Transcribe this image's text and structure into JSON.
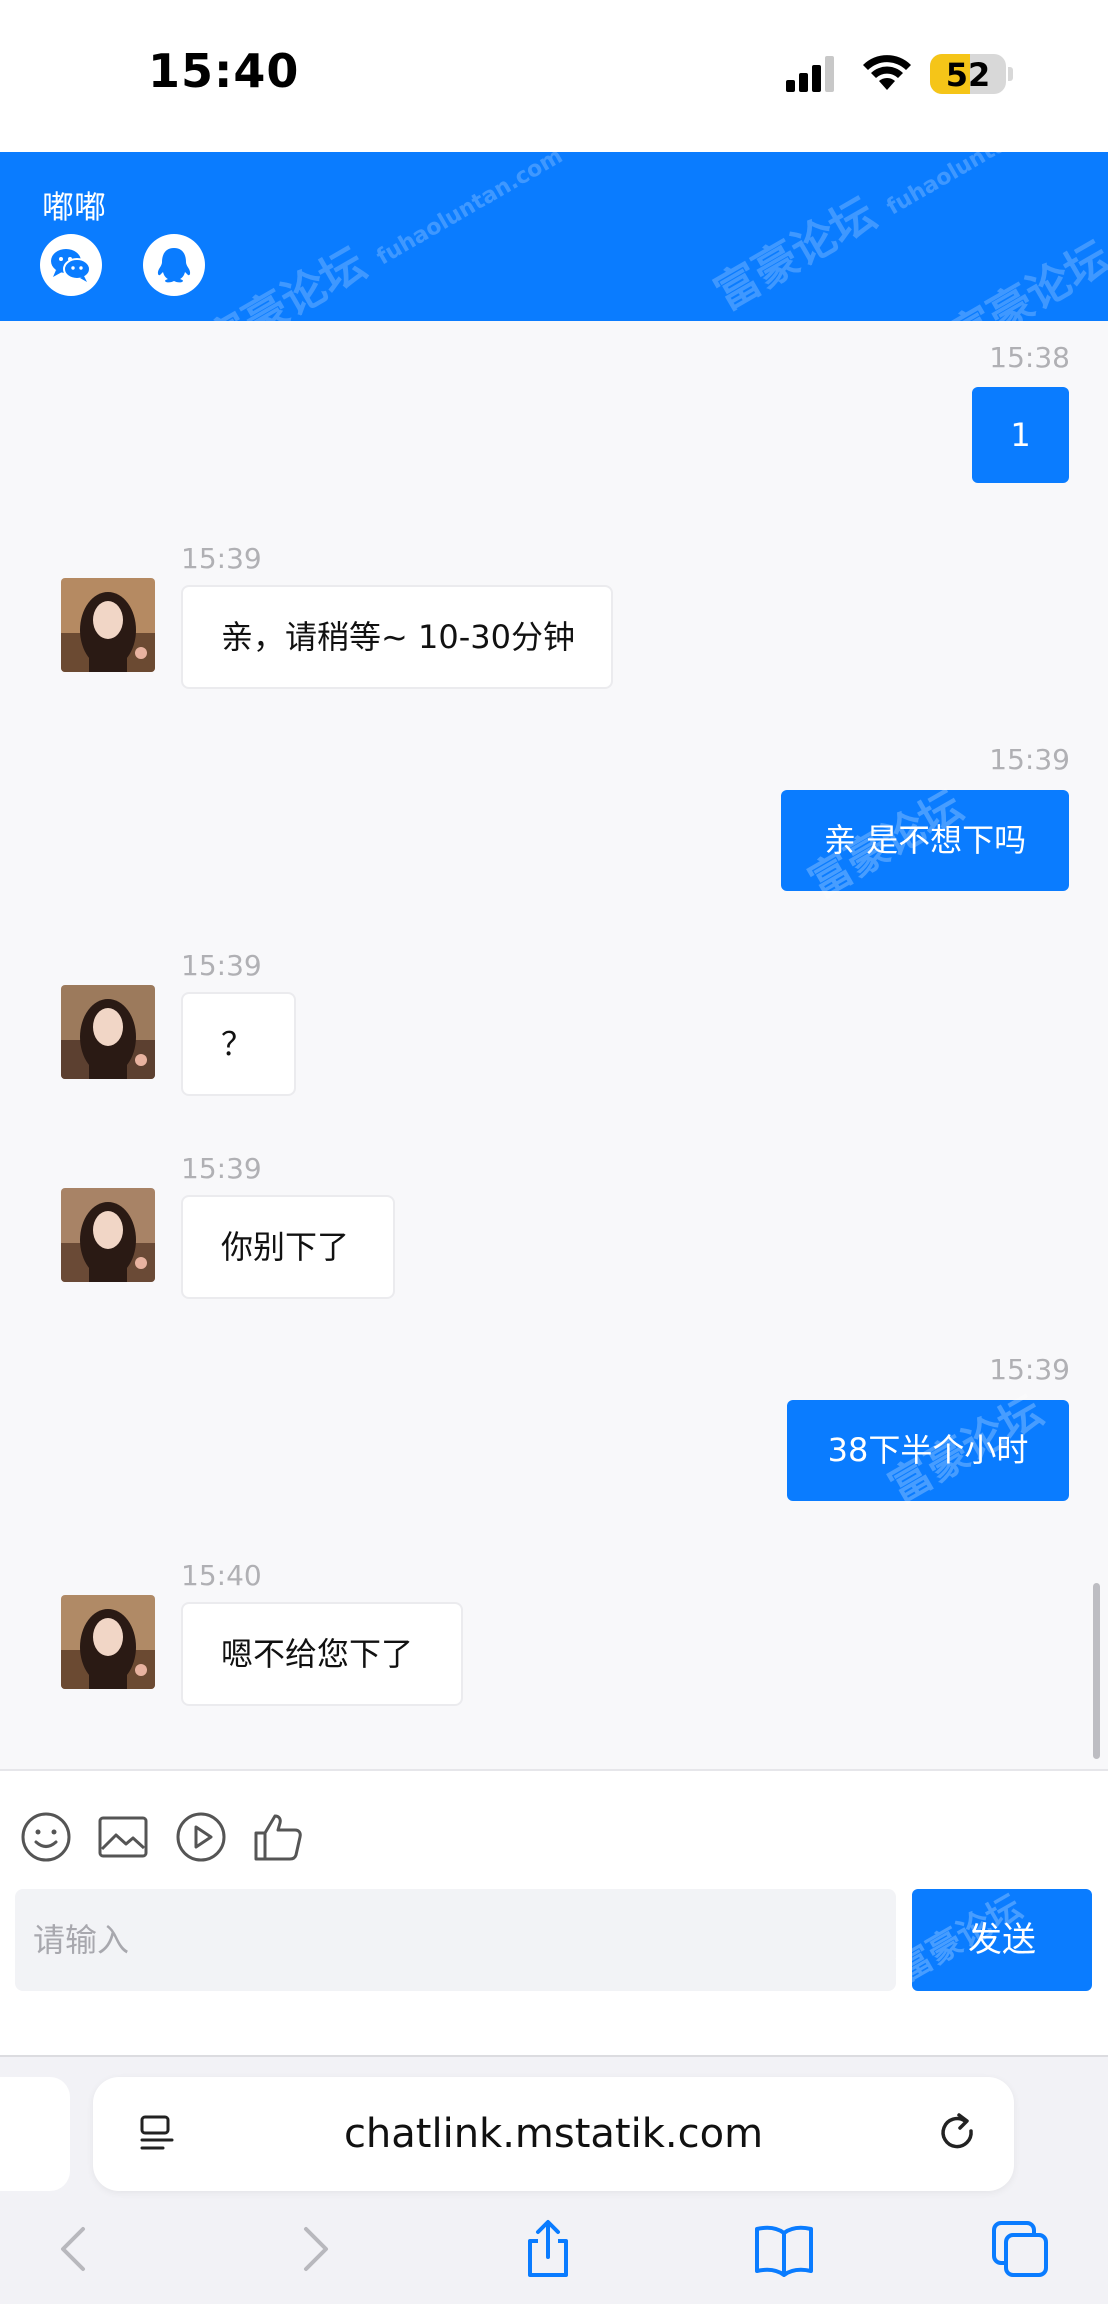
{
  "status_bar": {
    "time": "15:40",
    "battery": "52",
    "battery_level": 0.52
  },
  "header": {
    "title": "嘟嘟"
  },
  "watermark": {
    "brand": "富豪论坛",
    "domain": "fuhaoluntan.com"
  },
  "messages": [
    {
      "side": "out",
      "time": "15:38",
      "text": "1"
    },
    {
      "side": "in",
      "time": "15:39",
      "text": "亲，请稍等~ 10-30分钟"
    },
    {
      "side": "out",
      "time": "15:39",
      "text": "亲 是不想下吗"
    },
    {
      "side": "in",
      "time": "15:39",
      "text": "？"
    },
    {
      "side": "in",
      "time": "15:39",
      "text": "你别下了"
    },
    {
      "side": "out",
      "time": "15:39",
      "text": "38下半个小时"
    },
    {
      "side": "in",
      "time": "15:40",
      "text": "嗯不给您下了"
    }
  ],
  "composer": {
    "placeholder": "请输入",
    "send_label": "发送"
  },
  "browser": {
    "url": "chatlink.mstatik.com"
  },
  "colors": {
    "accent": "#0a7cff",
    "chat_bg": "#f8f8fa",
    "timestamp": "#b0b0b4"
  },
  "icons": [
    "wechat-icon",
    "qq-icon",
    "emoji-icon",
    "image-icon",
    "video-icon",
    "thumbs-up-icon",
    "reader-icon",
    "reload-icon",
    "back-icon",
    "forward-icon",
    "share-icon",
    "bookmarks-icon",
    "tabs-icon"
  ]
}
